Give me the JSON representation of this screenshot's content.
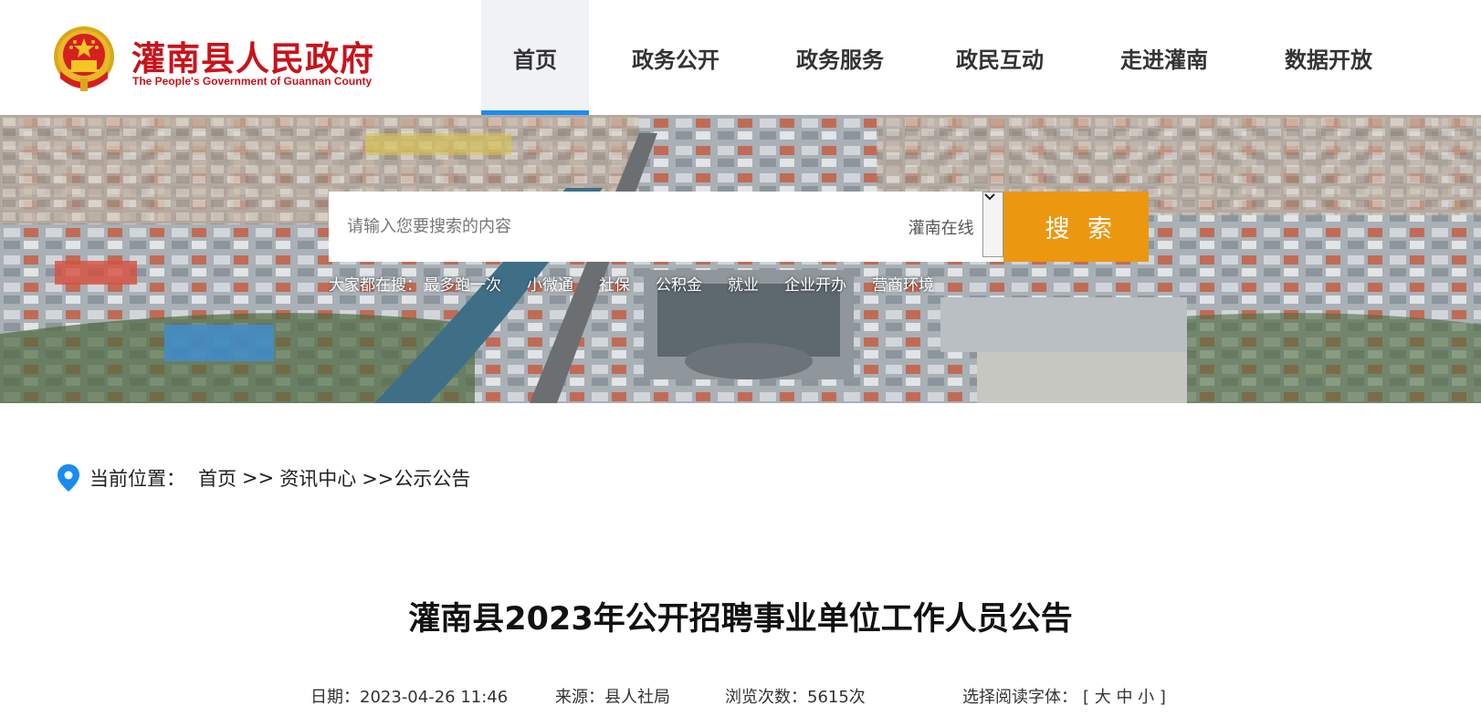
{
  "header": {
    "site_name": "灌南县人民政府",
    "site_name_en": "The People's Government of Guannan County",
    "brand_color": "#c8131a",
    "emblem_icon": "national-emblem-icon"
  },
  "nav": {
    "items": [
      {
        "label": "首页",
        "active": true
      },
      {
        "label": "政务公开",
        "active": false
      },
      {
        "label": "政务服务",
        "active": false
      },
      {
        "label": "政民互动",
        "active": false
      },
      {
        "label": "走进灌南",
        "active": false
      },
      {
        "label": "数据开放",
        "active": false
      }
    ],
    "active_color": "#1a8cf0"
  },
  "search": {
    "placeholder": "请输入您要搜索的内容",
    "scope": "灌南在线",
    "button_label": "搜 索",
    "button_color": "#eb9710",
    "hot_label": "大家都在搜：",
    "hot_links": [
      "最多跑一次",
      "小微通",
      "社保",
      "公积金",
      "就业",
      "企业开办",
      "营商环境"
    ]
  },
  "breadcrumb": {
    "label": "当前位置：",
    "path": [
      "首页",
      ">>",
      "资讯中心",
      ">>公示公告"
    ]
  },
  "article": {
    "title": "灌南县2023年公开招聘事业单位工作人员公告",
    "date": "日期：2023-04-26 11:46",
    "source": "来源：县人社局",
    "views": "浏览次数：5615次",
    "font_label": "选择阅读字体：",
    "font_sizes": "[ 大 中 小 ]"
  }
}
